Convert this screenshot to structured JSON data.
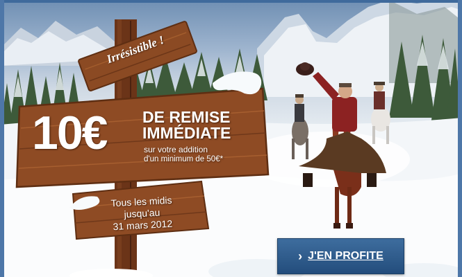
{
  "sign": {
    "tagline": "Irrésistible !",
    "amount": "10€",
    "remise_line1": "DE REMISE",
    "remise_line2": "IMMÉDIATE",
    "remise_line3": "sur votre addition",
    "remise_line4": "d'un minimum de 50€*",
    "dates_line1": "Tous les midis",
    "dates_line2": "jusqu'au",
    "dates_line3": "31 mars 2012"
  },
  "cta": {
    "label": "J'EN PROFITE",
    "icon": "chevron-right-icon"
  },
  "colors": {
    "wood": "#8b4a23",
    "wood_dark": "#5e2e12",
    "button": "#2f5d8d",
    "sky": "#7f9dbf"
  }
}
